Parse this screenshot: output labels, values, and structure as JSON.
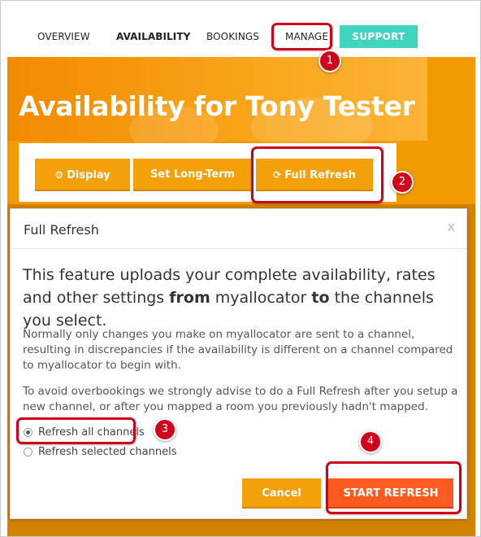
{
  "nav": {
    "items": [
      {
        "label": "OVERVIEW",
        "active": false
      },
      {
        "label": "AVAILABILITY",
        "active": true
      },
      {
        "label": "BOOKINGS",
        "active": false
      },
      {
        "label": "MANAGE",
        "active": false
      }
    ],
    "support_label": "SUPPORT",
    "support_color": "#40d3c0"
  },
  "page": {
    "title": "Availability for Tony Tester",
    "accent_color": "#f29a00"
  },
  "toolbar": {
    "display_label": "Display",
    "display_icon": "gear-icon",
    "long_term_label": "Set Long-Term",
    "full_refresh_label": "Full Refresh",
    "full_refresh_icon": "refresh-icon"
  },
  "modal": {
    "title": "Full Refresh",
    "close_label": "x",
    "lead_part1": "This feature uploads your complete availability, rates and other settings ",
    "lead_from": "from",
    "lead_part2": " myallocator ",
    "lead_to": "to",
    "lead_part3": " the channels you select.",
    "paragraph1": "Normally only changes you make on myallocator are sent to a channel, resulting in discrepancies if the availability is different on a channel compared to myallocator to begin with.",
    "paragraph2": "To avoid overbookings we strongly advise to do a Full Refresh after you setup a new channel, or after you mapped a room you previously hadn't mapped.",
    "options": [
      {
        "label": "Refresh all channels",
        "selected": true
      },
      {
        "label": "Refresh selected channels",
        "selected": false
      }
    ],
    "cancel_label": "Cancel",
    "start_label": "START REFRESH",
    "start_color": "#ff5a1f"
  },
  "annotations": {
    "step1": "1",
    "step2": "2",
    "step3": "3",
    "step4": "4",
    "highlight_color": "#d0021b"
  }
}
